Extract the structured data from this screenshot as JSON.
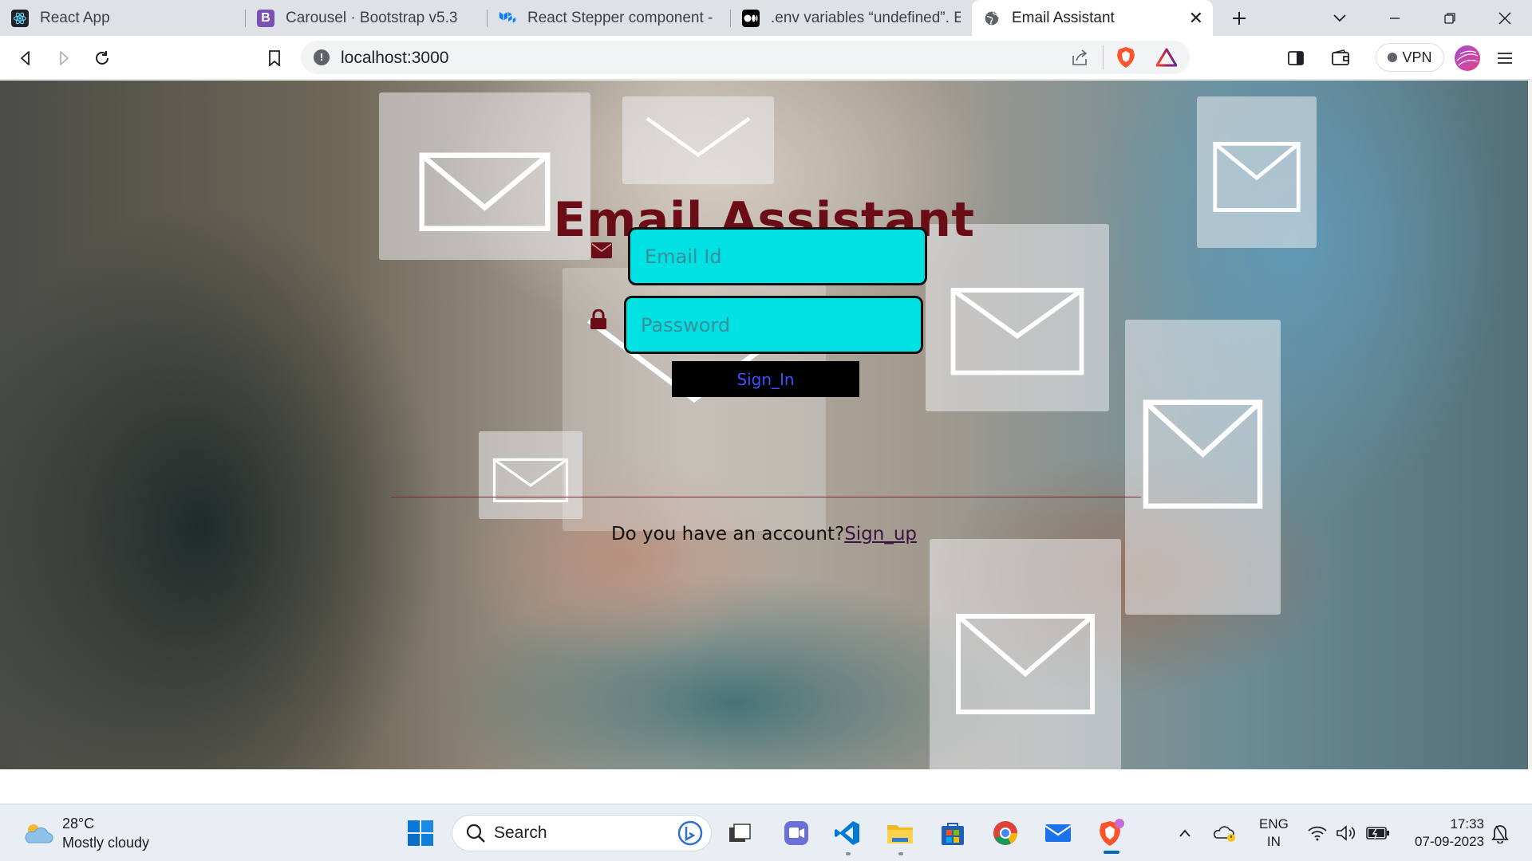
{
  "browser": {
    "tabs": [
      {
        "label": "React App",
        "icon": "react-icon"
      },
      {
        "label": "Carousel · Bootstrap v5.3",
        "icon": "bootstrap-icon"
      },
      {
        "label": "React Stepper component - Ma",
        "icon": "mui-icon"
      },
      {
        "label": ".env variables “undefined”. Eve",
        "icon": "medium-icon"
      },
      {
        "label": "Email Assistant",
        "icon": "globe-icon",
        "active": true
      }
    ],
    "address": "localhost:3000",
    "vpn_label": "VPN"
  },
  "page": {
    "title": "Email Assistant",
    "email_placeholder": "Email Id",
    "password_placeholder": "Password",
    "signin_label": "Sign_In",
    "account_prompt": "Do you have an account?",
    "signup_link": "Sign_up",
    "colors": {
      "title": "#6b0d16",
      "field_bg": "#00e1e3",
      "button_bg": "#000000",
      "button_text": "#3b50ff",
      "icon": "#6b0d16"
    }
  },
  "taskbar": {
    "weather_temp": "28°C",
    "weather_desc": "Mostly cloudy",
    "search_label": "Search",
    "lang_line1": "ENG",
    "lang_line2": "IN",
    "time": "17:33",
    "date": "07-09-2023",
    "apps": [
      "start-icon",
      "search-icon",
      "copilot-icon",
      "task-view-icon",
      "chat-icon",
      "vscode-icon",
      "file-explorer-icon",
      "store-icon",
      "chrome-icon",
      "mail-icon",
      "brave-icon"
    ]
  }
}
